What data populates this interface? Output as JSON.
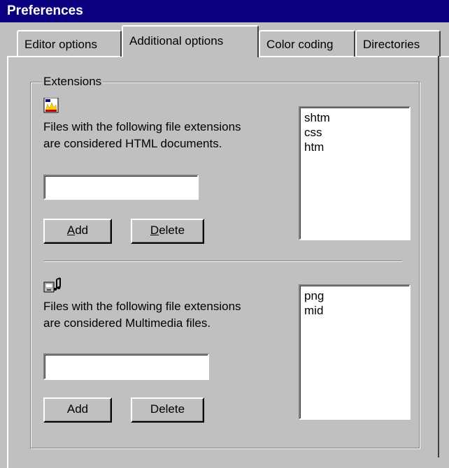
{
  "window": {
    "title": "Preferences"
  },
  "tabs": [
    {
      "label": "Editor options",
      "active": false
    },
    {
      "label": "Additional options",
      "active": true
    },
    {
      "label": "Color coding",
      "active": false
    },
    {
      "label": "Directories",
      "active": false
    }
  ],
  "extensions_group": {
    "legend": "Extensions",
    "html": {
      "icon": "html-document-icon",
      "description_line1": "Files with the following file extensions",
      "description_line2": "are considered HTML documents.",
      "input_value": "",
      "add_label_mnemonic": "A",
      "add_label_rest": "dd",
      "delete_label_mnemonic": "D",
      "delete_label_rest": "elete",
      "extensions": [
        "shtm",
        "css",
        "htm"
      ]
    },
    "multimedia": {
      "icon": "multimedia-icon",
      "description_line1": "Files with the following file extensions",
      "description_line2": "are considered Multimedia files.",
      "input_value": "",
      "add_label": "Add",
      "delete_label": "Delete",
      "extensions": [
        "png",
        "mid"
      ]
    }
  },
  "colors": {
    "titlebar": "#0a0080",
    "face": "#c0c0c0",
    "field": "#ffffff"
  }
}
